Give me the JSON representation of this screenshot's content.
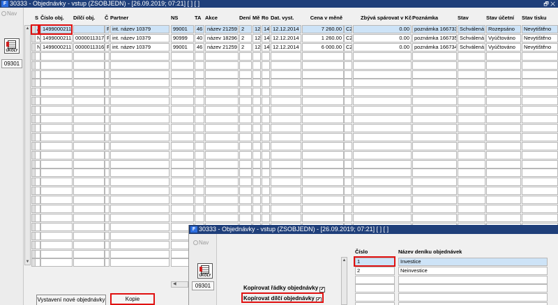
{
  "window": {
    "title": "30333 - Objednávky - vstup (ZSOBJEDN) - [26.09.2019; 07:21] [ ] [ ]",
    "logo": "F",
    "controls": "🗗 ✕"
  },
  "sidebar": {
    "nav_label": "Nav",
    "icon_label": "ÚKOLY",
    "code": "09301"
  },
  "table": {
    "columns": [
      "S",
      "Číslo obj.",
      "Dílčí obj.",
      "Č",
      "Partner",
      "NS",
      "TA",
      "Akce",
      "Dení",
      "Mě",
      "Ro",
      "Dat. vyst.",
      "Cena v měně",
      "Zbývá spárovat v Kč",
      "Poznámka",
      "Stav",
      "Stav účetní",
      "Stav tisku"
    ],
    "rows": [
      [
        "A",
        "1499000211",
        "",
        "F",
        "int. název 10379",
        "99001",
        "46",
        "název 21259",
        "2",
        "12",
        "14",
        "12.12.2014",
        "7 260.00",
        "CZK",
        "0.00",
        "poznámka 166733",
        "Schválená",
        "Rozepsáno",
        "Nevytištěno"
      ],
      [
        "N",
        "1499000211",
        "0000011317",
        "F",
        "int. název 10379",
        "90999",
        "40",
        "název 18296",
        "2",
        "12",
        "14",
        "12.12.2014",
        "1 260.00",
        "CZK",
        "0.00",
        "poznámka 166735",
        "Schválená",
        "Vyúčtováno",
        "Nevytištěno"
      ],
      [
        "N",
        "1499000211",
        "0000011316",
        "F",
        "int. název 10379",
        "99001",
        "46",
        "název 21259",
        "2",
        "12",
        "14",
        "12.12.2014",
        "6 000.00",
        "CZK",
        "0.00",
        "poznámka 166734",
        "Schválená",
        "Vyúčtováno",
        "Nevytištěno"
      ]
    ]
  },
  "buttons": {
    "new_order": "Vystavení nové objednávky",
    "copy": "Kopie"
  },
  "dialog": {
    "title": "30333 - Objednávky - vstup (ZSOBJEDN) - [26.09.2019; 07:21] [ ] [ ]",
    "logo": "F",
    "nav_label": "Nav",
    "icon_label": "ÚKOLY",
    "code": "09301",
    "copy_lines_label": "Kopírovat řádky objednávky",
    "copy_lines_check": "✓",
    "copy_sub_label": "Kopírovat dílčí objednávky",
    "copy_sub_check": "✓",
    "col_number": "Číslo",
    "col_name": "Název deníku objednávek",
    "journal_rows": [
      {
        "number": "1",
        "name": "Investice"
      },
      {
        "number": "2",
        "name": "Neinvestice"
      }
    ]
  }
}
